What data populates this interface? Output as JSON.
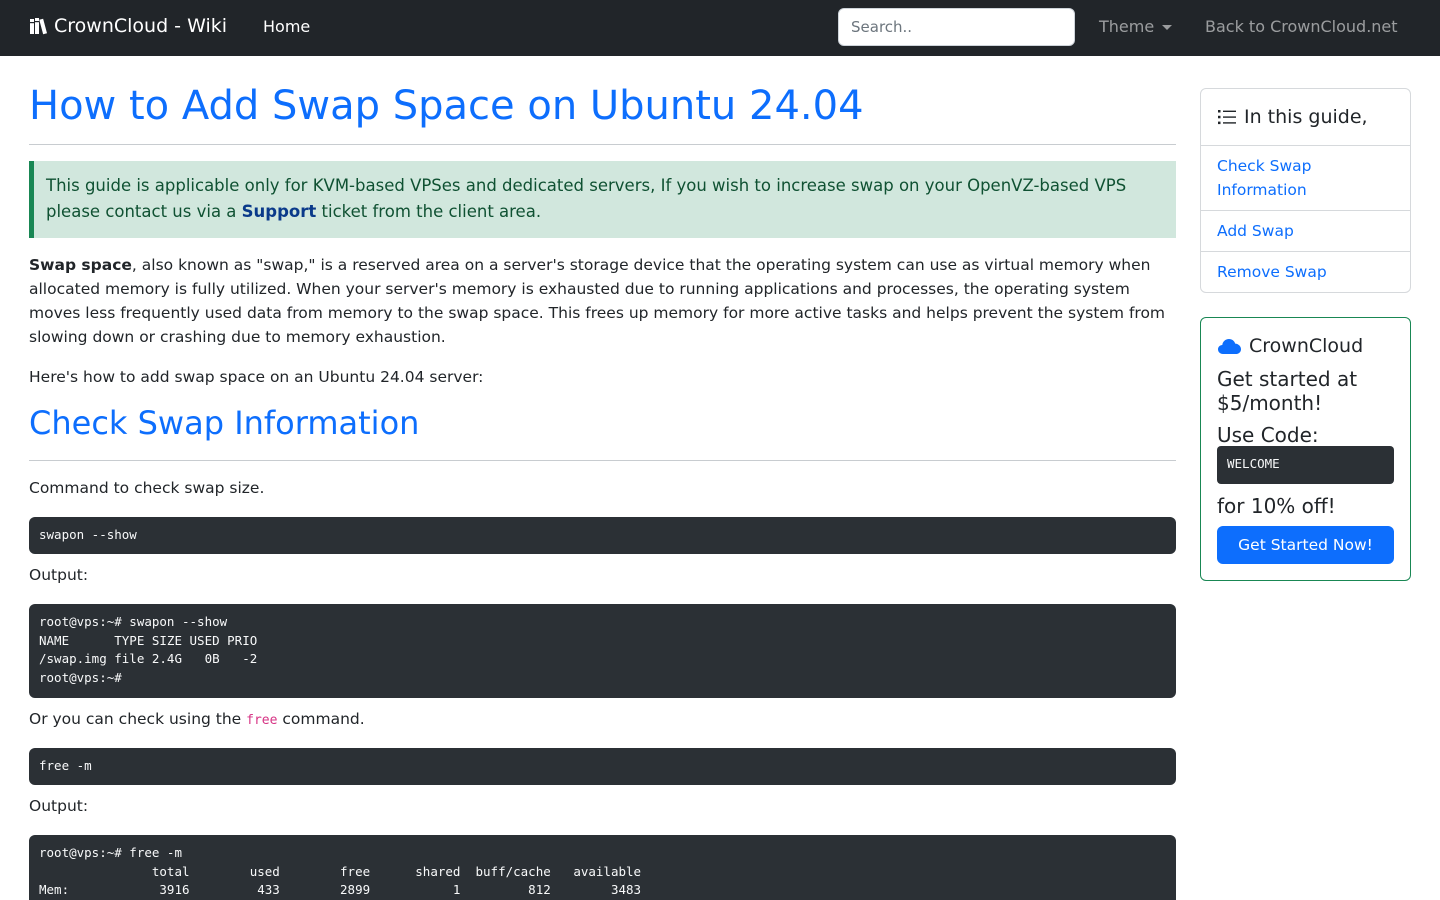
{
  "nav": {
    "brand": "CrownCloud - Wiki",
    "home": "Home",
    "search_placeholder": "Search..",
    "theme": "Theme",
    "back": "Back to CrownCloud.net"
  },
  "colors": {
    "navbar": "#212529",
    "link": "#0d6efd",
    "alert_bg": "#d1e7dd",
    "alert_border": "#198754",
    "code_bg": "#2b3035"
  },
  "main": {
    "title": "How to Add Swap Space on Ubuntu 24.04",
    "alert": {
      "before": "This guide is applicable only for KVM-based VPSes and dedicated servers, If you wish to increase swap on your OpenVZ-based VPS please contact us via a ",
      "link": "Support",
      "after": " ticket from the client area."
    },
    "intro_bold": "Swap space",
    "intro_rest": ", also known as \"swap,\" is a reserved area on a server's storage device that the operating system can use as virtual memory when allocated memory is fully utilized. When your server's memory is exhausted due to running applications and processes, the operating system moves less frequently used data from memory to the swap space. This frees up memory for more active tasks and helps prevent the system from slowing down or crashing due to memory exhaustion.",
    "howto": "Here's how to add swap space on an Ubuntu 24.04 server:",
    "section1_title": "Check Swap Information",
    "cmd_check_label": "Command to check swap size.",
    "cmd_check": "swapon --show",
    "output_label_1": "Output:",
    "output_1": "root@vps:~# swapon --show\nNAME      TYPE SIZE USED PRIO\n/swap.img file 2.4G   0B   -2\nroot@vps:~#",
    "alt_before": "Or you can check using the ",
    "alt_code": "free",
    "alt_after": " command.",
    "cmd_free": "free -m",
    "output_label_2": "Output:",
    "output_2": "root@vps:~# free -m\n               total        used        free      shared  buff/cache   available\nMem:            3916         433        2899           1         812        3483"
  },
  "toc": {
    "header": "In this guide,",
    "items": [
      {
        "label": "Check Swap Information"
      },
      {
        "label": "Add Swap"
      },
      {
        "label": "Remove Swap"
      }
    ]
  },
  "promo": {
    "brand": "CrownCloud",
    "line1": "Get started at $5/month!",
    "line2": "Use Code:",
    "code": "WELCOME",
    "line3": "for 10% off!",
    "button": "Get Started Now!"
  }
}
